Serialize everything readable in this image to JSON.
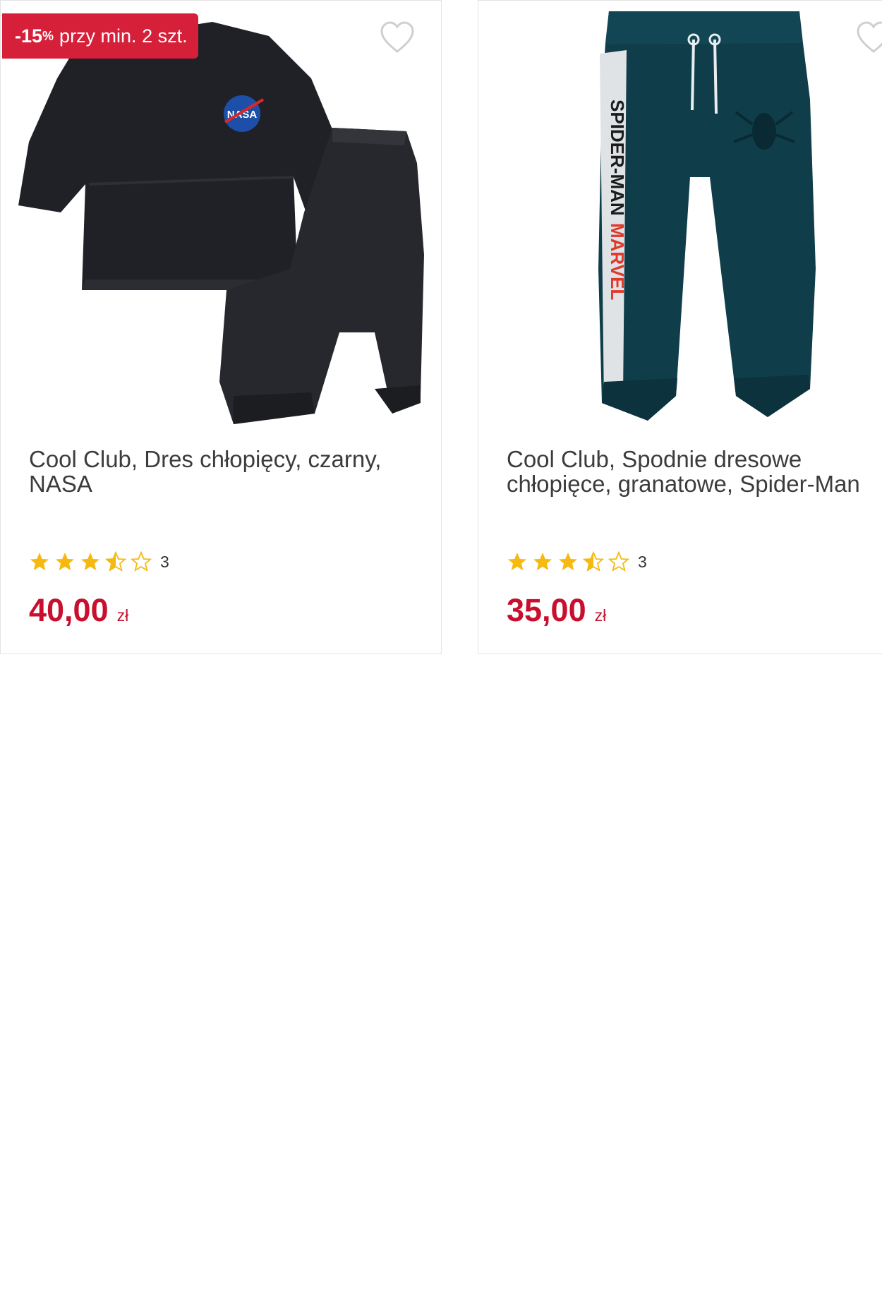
{
  "colors": {
    "accent": "#c8102e",
    "badge_bg": "#d6203a",
    "star_fill": "#f5b90f",
    "heart_outline": "#cfcfcf"
  },
  "products": [
    {
      "badge": {
        "percent": "-15",
        "percent_sign": "%",
        "text": "przy min. 2 szt."
      },
      "title": "Cool Club, Dres chłopięcy, czarny, NASA",
      "image_alt": "black sweatshirt and joggers set with NASA logo",
      "rating": {
        "stars": 3.5,
        "max": 5,
        "count": "3"
      },
      "price": {
        "amount": "40,00",
        "currency": "zł"
      },
      "icons": {
        "favorite": "heart-outline-icon",
        "star": "star-icon"
      }
    },
    {
      "title": "Cool Club, Spodnie dresowe chłopięce, granatowe, Spider-Man",
      "image_alt": "teal Spider-Man jogger pants",
      "rating": {
        "stars": 3.5,
        "max": 5,
        "count": "3"
      },
      "price": {
        "amount": "35,00",
        "currency": "zł"
      },
      "icons": {
        "favorite": "heart-outline-icon",
        "star": "star-icon"
      }
    }
  ]
}
